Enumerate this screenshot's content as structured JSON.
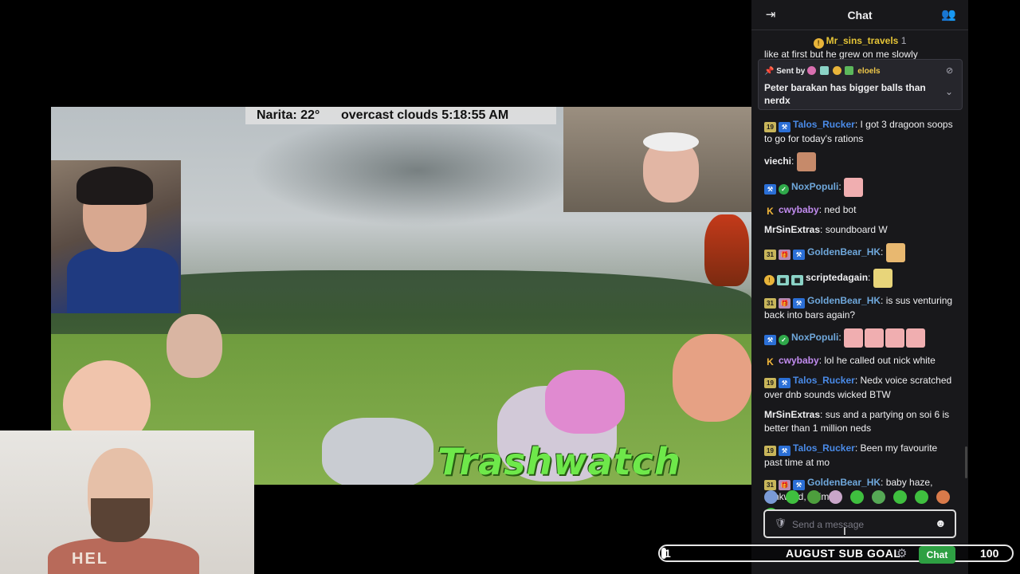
{
  "stream": {
    "weather_text": "Narita: 22°      overcast clouds 5:18:55 AM",
    "overlay_title": "Trashwatch"
  },
  "webcam": {
    "shirt_text": "HEL"
  },
  "chat": {
    "title": "Chat",
    "top_user": {
      "name": "Mr_sins_travels",
      "count": "1",
      "cutoff_text": "like at first but he grew on me slowly"
    },
    "pinned": {
      "sent_by_label": "Sent by",
      "sender": "eloels",
      "message": "Peter barakan has bigger balls than nerdx"
    },
    "messages": [
      {
        "badges": [
          "19",
          "mod"
        ],
        "user": "Talos_Rucker",
        "color": "#4a8be8",
        "text": "I got 3 dragoon soops to go for today's rations",
        "emotes": []
      },
      {
        "badges": [],
        "user": "viechi",
        "color": "#efeff1",
        "text": "",
        "emotes": [
          "face"
        ]
      },
      {
        "badges": [
          "mod",
          "verified"
        ],
        "user": "NoxPopuli",
        "color": "#6fa8dc",
        "text": "",
        "emotes": [
          "pink"
        ]
      },
      {
        "badges": [
          "k"
        ],
        "user": "cwybaby",
        "color": "#c28cf0",
        "text": "ned bot",
        "emotes": []
      },
      {
        "badges": [],
        "user": "MrSinExtras",
        "color": "#efeff1",
        "text": "soundboard W",
        "emotes": []
      },
      {
        "badges": [
          "31",
          "gift",
          "mod"
        ],
        "user": "GoldenBear_HK",
        "color": "#6fa8dc",
        "text": "",
        "emotes": [
          "sun"
        ]
      },
      {
        "badges": [
          "coin",
          "multi",
          "multi"
        ],
        "user": "scriptedagain",
        "color": "#efeff1",
        "text": "",
        "emotes": [
          "cheese"
        ]
      },
      {
        "badges": [
          "31",
          "gift",
          "mod"
        ],
        "user": "GoldenBear_HK",
        "color": "#6fa8dc",
        "text": "is sus venturing back into bars again?",
        "emotes": []
      },
      {
        "badges": [
          "mod",
          "verified"
        ],
        "user": "NoxPopuli",
        "color": "#6fa8dc",
        "text": "",
        "emotes": [
          "pink",
          "pink",
          "pink",
          "pink"
        ]
      },
      {
        "badges": [
          "k"
        ],
        "user": "cwybaby",
        "color": "#c28cf0",
        "text": "lol he called out nick white",
        "emotes": []
      },
      {
        "badges": [
          "19",
          "mod"
        ],
        "user": "Talos_Rucker",
        "color": "#4a8be8",
        "text": "Nedx voice scratched over dnb sounds wicked BTW",
        "emotes": []
      },
      {
        "badges": [],
        "user": "MrSinExtras",
        "color": "#efeff1",
        "text": "sus and a partying on soi 6 is better than 1 million neds",
        "emotes": []
      },
      {
        "badges": [
          "19",
          "mod"
        ],
        "user": "Talos_Rucker",
        "color": "#4a8be8",
        "text": "Been my favourite past time at mo",
        "emotes": []
      },
      {
        "badges": [
          "31",
          "gift",
          "mod"
        ],
        "user": "GoldenBear_HK",
        "color": "#6fa8dc",
        "text": "baby haze, stinkwind, n limes",
        "emotes": []
      }
    ],
    "input_placeholder": "Send a message",
    "chat_button": "Chat"
  },
  "sub_goal": {
    "label": "AUGUST SUB GOAL",
    "current": "1",
    "target": "100",
    "progress_fraction": 0.01
  },
  "colors": {
    "accent_green": "#2ea043",
    "chat_bg": "#18181b",
    "trashwatch_green": "#6ee84a"
  }
}
